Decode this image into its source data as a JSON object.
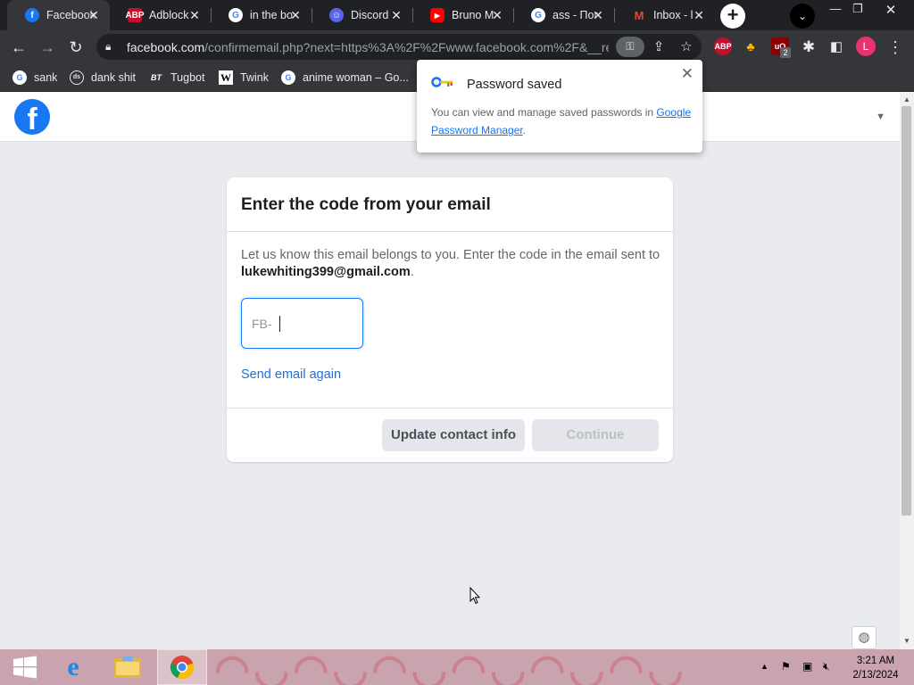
{
  "browser": {
    "tabs": [
      {
        "title": "Facebook",
        "favicon": "facebook-icon",
        "active": true
      },
      {
        "title": "Adblock",
        "favicon": "adblock-plus-icon"
      },
      {
        "title": "in the bo",
        "favicon": "google-icon"
      },
      {
        "title": "Discord",
        "favicon": "discord-icon"
      },
      {
        "title": "Bruno M",
        "favicon": "youtube-icon"
      },
      {
        "title": "ass - Пог",
        "favicon": "google-icon"
      },
      {
        "title": "Inbox - l",
        "favicon": "gmail-icon"
      }
    ],
    "url_domain": "facebook.com",
    "url_path": "/confirmemail.php?next=https%3A%2F%2Fwww.facebook.com%2F&__re...",
    "profile_initial": "L",
    "ublock_count": "2",
    "bookmarks": [
      {
        "label": "sank",
        "icon": "google-icon"
      },
      {
        "label": "dank shit",
        "icon": "folder-badge-icon"
      },
      {
        "label": "Tugbot",
        "icon": "bt-icon"
      },
      {
        "label": "Twink",
        "icon": "wikipedia-icon"
      },
      {
        "label": "anime woman – Go...",
        "icon": "google-icon"
      }
    ]
  },
  "password_popup": {
    "title": "Password saved",
    "body_text": "You can view and manage saved passwords in ",
    "link_text": "Google Password Manager",
    "body_end": "."
  },
  "card": {
    "title": "Enter the code from your email",
    "desc_prefix": "Let us know this email belongs to you. Enter the code in the email sent to ",
    "email": "lukewhiting399@gmail.com",
    "desc_suffix": ".",
    "code_prefix": "FB-",
    "resend_label": "Send email again",
    "update_label": "Update contact info",
    "continue_label": "Continue"
  },
  "taskbar": {
    "time": "3:21 AM",
    "date": "2/13/2024"
  },
  "colors": {
    "facebook_blue": "#1877f2",
    "link_blue": "#216fdb",
    "chrome_dark": "#202124"
  }
}
